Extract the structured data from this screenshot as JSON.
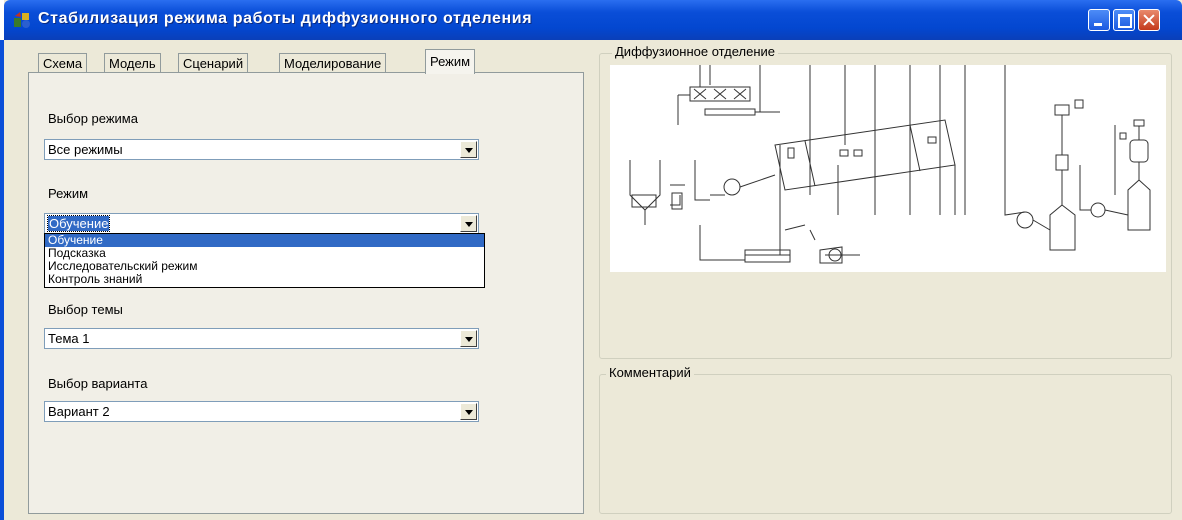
{
  "window": {
    "title": "Стабилизация режима работы диффузионного отделения"
  },
  "tabs": [
    "Схема",
    "Модель",
    "Сценарий",
    "Моделирование",
    "Режим"
  ],
  "active_tab": "Режим",
  "form": {
    "mode_select_label": "Выбор режима",
    "mode_select_value": "Все режимы",
    "regime_label": "Режим",
    "regime_value": "Обучение",
    "regime_options": [
      "Обучение",
      "Подсказка",
      "Исследовательский режим",
      "Контроль знаний"
    ],
    "topic_label": "Выбор темы",
    "topic_value": "Тема 1",
    "variant_label": "Выбор варианта",
    "variant_value": "Вариант 2"
  },
  "diagram_group": {
    "title": "Диффузионное отделение"
  },
  "comment_group": {
    "title": "Комментарий"
  },
  "colors": {
    "titlebar": "#0a4ed8",
    "window_bg": "#ece9d8",
    "selection": "#316ac5"
  }
}
